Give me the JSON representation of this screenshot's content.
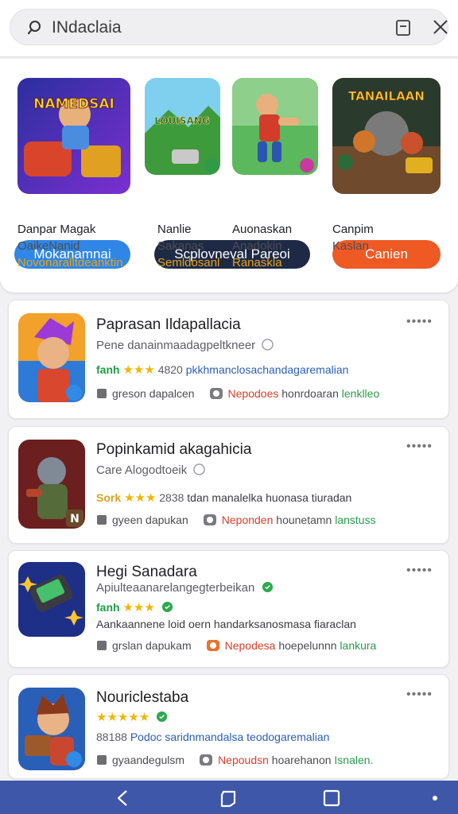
{
  "search": {
    "value": "INdaclaia"
  },
  "featured": [
    {
      "banner_text": "NAMEDSAI",
      "cta": "Mokanamnai",
      "line1": "Danpar Magak",
      "line2": "OaikeNanid",
      "line3": "Novonaralltdeanktin."
    },
    {
      "banner_text": "LOUISANG",
      "cta": "Scplovneval Pareoi",
      "line1": "Nanlie",
      "line2": "Sakanas",
      "line3": "Semldosanl"
    },
    {
      "banner_text": "",
      "cta": "",
      "line1": "Auonaskan",
      "line2": "Anadokin",
      "line3": "Ranaskla"
    },
    {
      "banner_text": "TANAILAAN",
      "cta": "Canien",
      "line1": "Canpim",
      "line2": "Kaslan",
      "line3": ""
    }
  ],
  "apps": [
    {
      "title": "Paprasan Ildapallacia",
      "developer": "Pene danainmaadagpeltkneer",
      "rating_word": "fanh",
      "stars": "★★★",
      "rating_count": "4820",
      "rating_desc": "pkkhmanclosachandagaremalian",
      "meta_left": "greson dapalcen",
      "meta_red": "Nepodoes",
      "meta_mid": "honrdoaran",
      "meta_green": "lenklleo"
    },
    {
      "title": "Popinkamid akagahicia",
      "developer": "Care Alogodtoeik",
      "rating_word": "Sork",
      "stars": "★★★",
      "rating_count": "2838",
      "rating_desc": "tdan manalelka huonasa tiuradan",
      "meta_left": "gyeen dapukan",
      "meta_red": "Neponden",
      "meta_mid": "hounetamn",
      "meta_green": "lanstuss"
    },
    {
      "title": "Hegi Sanadara",
      "developer": "Apiulteaanarelangegterbeikan",
      "rating_word": "fanh",
      "stars": "★★★",
      "rating_count": "",
      "rating_desc": "Aankaannene loid oern handarksanosmasa fiaraclan",
      "meta_left": "grslan dapukam",
      "meta_red": "Nepodesa",
      "meta_mid": "hoepelunnn",
      "meta_green": "lankura"
    },
    {
      "title": "Nouriclestaba",
      "developer": "",
      "rating_word": "",
      "stars": "★★★★★",
      "rating_count": "88188",
      "rating_desc": "Podoc saridnmandalsa teodogaremalian",
      "meta_left": "gyaandegulsm",
      "meta_red": "Nepoudsn",
      "meta_mid": "hoarehanon",
      "meta_green": "Isnalen."
    }
  ],
  "colors": {
    "accent_blue": "#2f86e6",
    "navy": "#1e2a45",
    "orange": "#ef5a24",
    "nav_bar": "#3f57a8",
    "rating_green": "#1f9e45",
    "meta_red": "#d6402a"
  }
}
